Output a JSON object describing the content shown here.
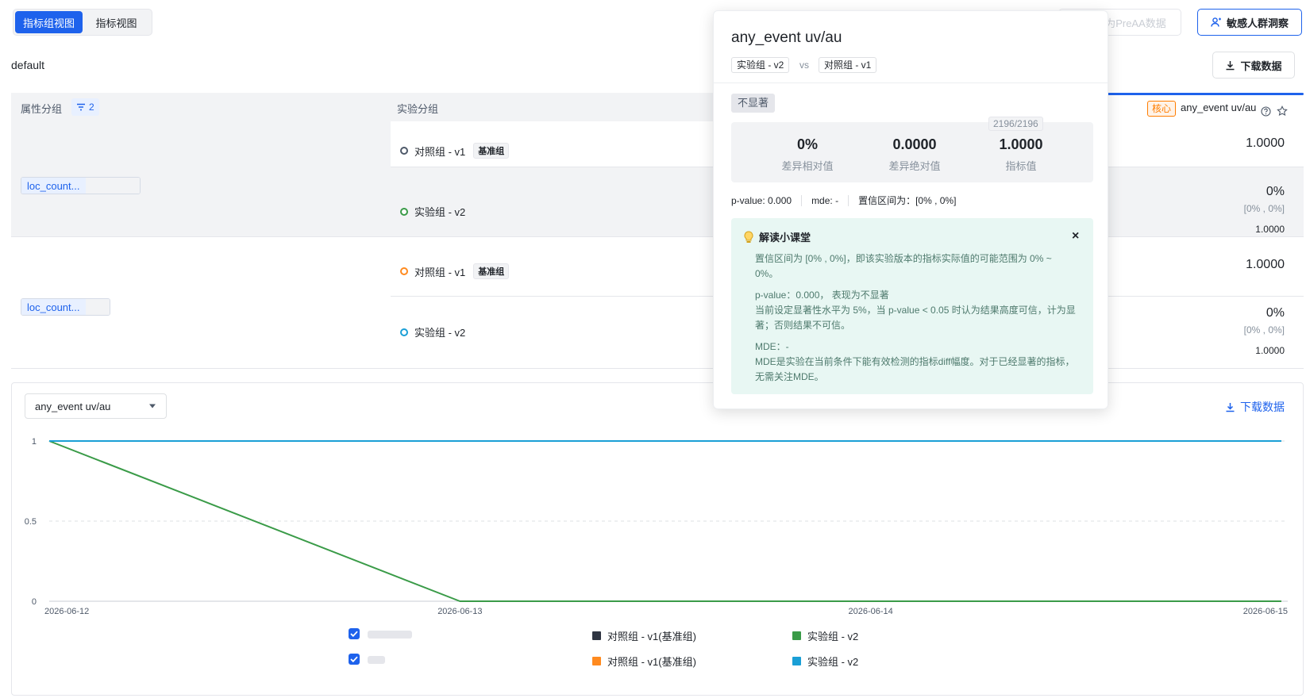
{
  "view_toggle": {
    "group_view": "指标组视图",
    "metric_view": "指标视图"
  },
  "title": "default",
  "toolbar": {
    "preaa_label": "为PreAA数据",
    "sensitive_label": "敏感人群洞察",
    "download_label": "下载数据"
  },
  "table": {
    "header": {
      "attr_group": "属性分组",
      "filter_count": "2",
      "exp_group": "实验分组",
      "core_badge": "核心",
      "metric_name": "any_event uv/au"
    },
    "groups": [
      {
        "tag": "loc_count...",
        "rows": [
          {
            "variant": "对照组 - v1",
            "badge": "基准组",
            "value": "1.0000",
            "dot_color": "#4e5969"
          },
          {
            "variant": "实验组 - v2",
            "diff": "0%",
            "ci": "[0% , 0%]",
            "value": "1.0000",
            "dot_color": "#3a9b48"
          }
        ]
      },
      {
        "tag": "loc_count...",
        "rows": [
          {
            "variant": "对照组 - v1",
            "badge": "基准组",
            "value": "1.0000",
            "dot_color": "#ff8a1f"
          },
          {
            "variant": "实验组 - v2",
            "diff": "0%",
            "ci": "[0% , 0%]",
            "value": "1.0000",
            "dot_color": "#1a9fd6"
          }
        ]
      }
    ]
  },
  "popover": {
    "title": "any_event uv/au",
    "compare_a": "实验组 - v2",
    "vs": "vs",
    "compare_b": "对照组 - v1",
    "significance": "不显著",
    "stats": [
      {
        "value": "0%",
        "label": "差异相对值"
      },
      {
        "value": "0.0000",
        "label": "差异绝对值"
      },
      {
        "value": "1.0000",
        "label": "指标值"
      }
    ],
    "sample": "2196/2196",
    "pvalue": "p-value: 0.000",
    "mde": "mde: -",
    "ci": "置信区间为：[0% , 0%]",
    "tip": {
      "title": "解读小课堂",
      "close": "×",
      "ci_line1": "置信区间为 [0% , 0%]，即该实验版本的指标实际值的可能范围为 0% ~",
      "ci_line2": "0%。",
      "p_line1": "p-value：0.000， 表现为不显著",
      "p_line2": "当前设定显著性水平为 5%，当 p-value < 0.05 时认为结果高度可信，计为显",
      "p_line3": "著；否则结果不可信。",
      "mde_line1": "MDE：-",
      "mde_line2": "MDE是实验在当前条件下能有效检测的指标diff幅度。对于已经显著的指标，",
      "mde_line3": "无需关注MDE。"
    }
  },
  "chart_panel": {
    "selected_metric": "any_event uv/au",
    "download_label": "下载数据"
  },
  "chart_data": {
    "type": "line",
    "x": [
      "2026-06-12",
      "2026-06-13",
      "2026-06-14",
      "2026-06-15"
    ],
    "yticks": [
      "1",
      "0.5",
      "0"
    ],
    "ylim": [
      0,
      1
    ],
    "grid": true,
    "series": [
      {
        "name": "对照组 - v1(基准组)",
        "color": "#2f3542",
        "values": [
          1,
          1,
          1,
          1
        ]
      },
      {
        "name": "实验组 - v2",
        "color": "#3a9b48",
        "values": [
          1,
          0,
          0,
          0
        ]
      },
      {
        "name": "对照组 - v1(基准组)",
        "color": "#ff8a1f",
        "values": [
          1,
          1,
          1,
          1
        ]
      },
      {
        "name": "实验组 - v2",
        "color": "#1a9fd6",
        "values": [
          1,
          1,
          1,
          1
        ]
      }
    ]
  }
}
